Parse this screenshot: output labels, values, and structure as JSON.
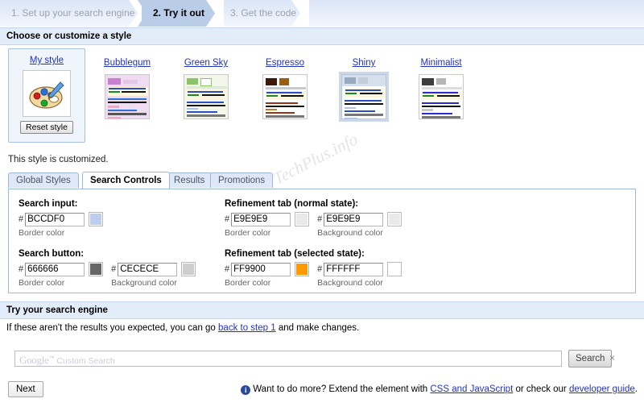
{
  "wizard": {
    "steps": [
      {
        "label": "1. Set up your search engine",
        "active": false
      },
      {
        "label": "2. Try it out",
        "active": true
      },
      {
        "label": "3. Get the code",
        "active": false
      }
    ]
  },
  "style_section": {
    "header": "Choose or customize a style",
    "my_style": {
      "label": "My style",
      "reset_label": "Reset style",
      "icon": "palette-icon"
    },
    "presets": [
      {
        "label": "Bubblegum"
      },
      {
        "label": "Green Sky"
      },
      {
        "label": "Espresso"
      },
      {
        "label": "Shiny"
      },
      {
        "label": "Minimalist"
      }
    ],
    "note": "This style is customized."
  },
  "tabs": [
    {
      "label": "Global Styles",
      "active": false
    },
    {
      "label": "Search Controls",
      "active": true
    },
    {
      "label": "Results",
      "active": false
    },
    {
      "label": "Promotions",
      "active": false
    }
  ],
  "controls": {
    "search_input": {
      "title": "Search input:",
      "border": {
        "hash": "#",
        "value": "BCCDF0",
        "swatch": "#BCCDF0",
        "caption": "Border color"
      }
    },
    "search_button": {
      "title": "Search button:",
      "border": {
        "hash": "#",
        "value": "666666",
        "swatch": "#666666",
        "caption": "Border color"
      },
      "background": {
        "hash": "#",
        "value": "CECECE",
        "swatch": "#CECECE",
        "caption": "Background color"
      }
    },
    "refinement_normal": {
      "title": "Refinement tab (normal state):",
      "border": {
        "hash": "#",
        "value": "E9E9E9",
        "swatch": "#E9E9E9",
        "caption": "Border color"
      },
      "background": {
        "hash": "#",
        "value": "E9E9E9",
        "swatch": "#E9E9E9",
        "caption": "Background color"
      }
    },
    "refinement_selected": {
      "title": "Refinement tab (selected state):",
      "border": {
        "hash": "#",
        "value": "FF9900",
        "swatch": "#FF9900",
        "caption": "Border color"
      },
      "background": {
        "hash": "#",
        "value": "FFFFFF",
        "swatch": "#FFFFFF",
        "caption": "Background color"
      }
    }
  },
  "try_section": {
    "header": "Try your search engine",
    "desc_before": "If these aren't the results you expected, you can go ",
    "desc_link": "back to step 1",
    "desc_after": " and make changes.",
    "search": {
      "value": "",
      "placeholder_brand": "Google",
      "placeholder_tm": "™",
      "placeholder_text": "Custom Search",
      "button_label": "Search",
      "close_label": "×"
    }
  },
  "footer": {
    "next_label": "Next",
    "note_before": "Want to do more? Extend the element with ",
    "note_link1": "CSS and JavaScript",
    "note_middle": " or check our ",
    "note_link2": "developer guide",
    "note_after": "."
  },
  "watermark": "TechPlus.info",
  "colors": {
    "accent": "#2233bb",
    "header_bg": "#e3ecf9",
    "tab_border": "#9db8d9",
    "wizard_active": "#b9cde9"
  }
}
